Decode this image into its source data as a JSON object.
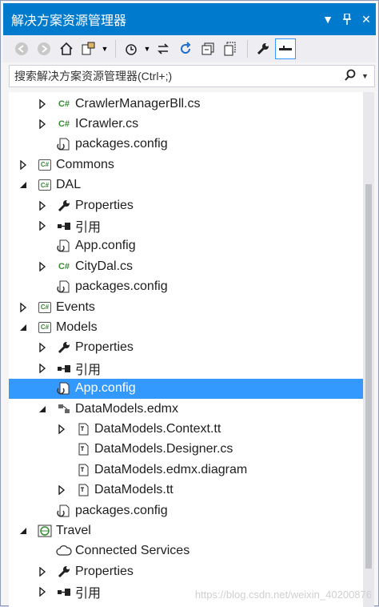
{
  "title": "解决方案资源管理器",
  "search_placeholder": "搜索解决方案资源管理器(Ctrl+;)",
  "tree": [
    {
      "label": "CrawlerManagerBll.cs",
      "icon": "csharp-file-icon",
      "arrow": "collapsed",
      "level": 2
    },
    {
      "label": "ICrawler.cs",
      "icon": "csharp-file-icon",
      "arrow": "collapsed",
      "level": 2
    },
    {
      "label": "packages.config",
      "icon": "config-file-icon",
      "arrow": "none",
      "level": 2
    },
    {
      "label": "Commons",
      "icon": "csharp-project-icon",
      "arrow": "collapsed",
      "level": 1
    },
    {
      "label": "DAL",
      "icon": "csharp-project-icon",
      "arrow": "expanded",
      "level": 1
    },
    {
      "label": "Properties",
      "icon": "wrench-icon",
      "arrow": "collapsed",
      "level": 2
    },
    {
      "label": "引用",
      "icon": "references-icon",
      "arrow": "collapsed",
      "level": 2
    },
    {
      "label": "App.config",
      "icon": "config-file-icon",
      "arrow": "none",
      "level": 2
    },
    {
      "label": "CityDal.cs",
      "icon": "csharp-file-icon",
      "arrow": "collapsed",
      "level": 2
    },
    {
      "label": "packages.config",
      "icon": "config-file-icon",
      "arrow": "none",
      "level": 2
    },
    {
      "label": "Events",
      "icon": "csharp-project-icon",
      "arrow": "collapsed",
      "level": 1
    },
    {
      "label": "Models",
      "icon": "csharp-project-icon",
      "arrow": "expanded",
      "level": 1
    },
    {
      "label": "Properties",
      "icon": "wrench-icon",
      "arrow": "collapsed",
      "level": 2
    },
    {
      "label": "引用",
      "icon": "references-icon",
      "arrow": "collapsed",
      "level": 2
    },
    {
      "label": "App.config",
      "icon": "config-file-icon",
      "arrow": "none",
      "level": 2,
      "selected": true
    },
    {
      "label": "DataModels.edmx",
      "icon": "edmx-icon",
      "arrow": "expanded",
      "level": 2
    },
    {
      "label": "DataModels.Context.tt",
      "icon": "tt-file-icon",
      "arrow": "collapsed",
      "level": 3
    },
    {
      "label": "DataModels.Designer.cs",
      "icon": "tt-file-icon",
      "arrow": "none",
      "level": 3
    },
    {
      "label": "DataModels.edmx.diagram",
      "icon": "tt-file-icon",
      "arrow": "none",
      "level": 3
    },
    {
      "label": "DataModels.tt",
      "icon": "tt-file-icon",
      "arrow": "collapsed",
      "level": 3
    },
    {
      "label": "packages.config",
      "icon": "config-file-icon",
      "arrow": "none",
      "level": 2
    },
    {
      "label": "Travel",
      "icon": "web-project-icon",
      "arrow": "expanded",
      "level": 1
    },
    {
      "label": "Connected Services",
      "icon": "cloud-icon",
      "arrow": "none",
      "level": 2
    },
    {
      "label": "Properties",
      "icon": "wrench-icon",
      "arrow": "collapsed",
      "level": 2
    },
    {
      "label": "引用",
      "icon": "references-icon",
      "arrow": "collapsed",
      "level": 2
    }
  ],
  "watermark": "https://blog.csdn.net/weixin_40200876"
}
